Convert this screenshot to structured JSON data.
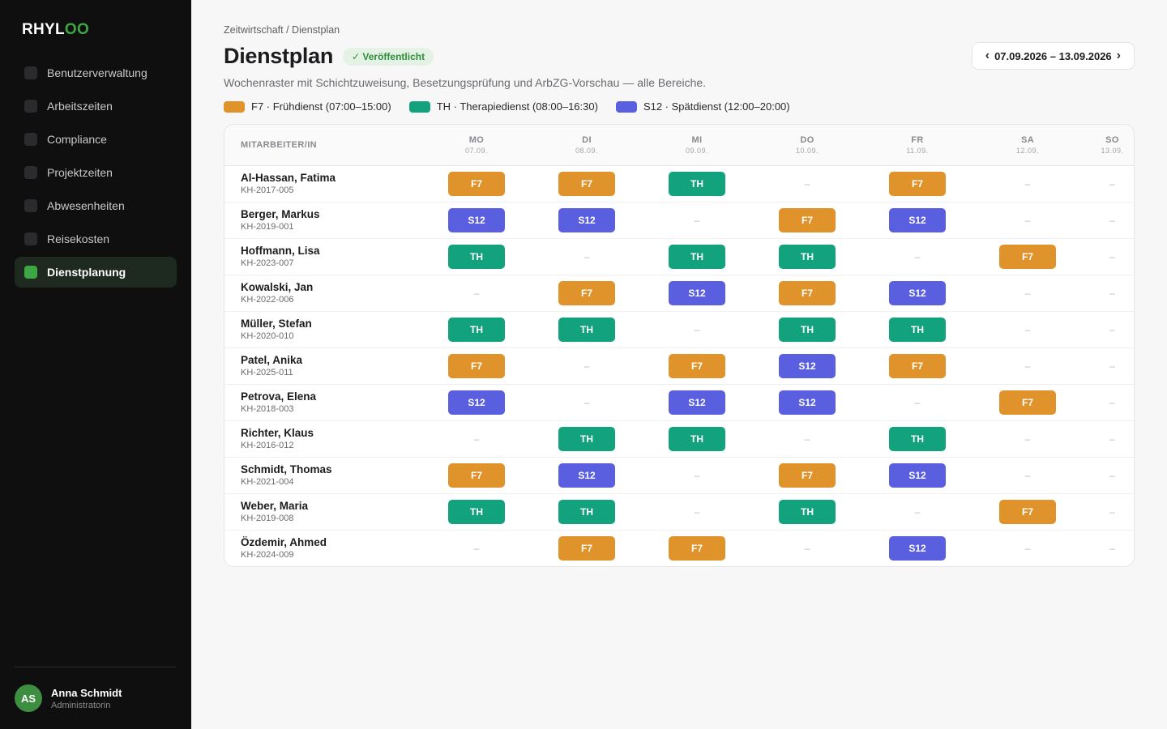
{
  "app": {
    "logo_main": "RHYL",
    "logo_accent": "OO"
  },
  "sidebar": {
    "items": [
      {
        "label": "Benutzerverwaltung",
        "active": false
      },
      {
        "label": "Arbeitszeiten",
        "active": false
      },
      {
        "label": "Compliance",
        "active": false
      },
      {
        "label": "Projektzeiten",
        "active": false
      },
      {
        "label": "Abwesenheiten",
        "active": false
      },
      {
        "label": "Reisekosten",
        "active": false
      },
      {
        "label": "Dienstplanung",
        "active": true
      }
    ],
    "user": {
      "initials": "AS",
      "name": "Anna Schmidt",
      "role": "Administratorin"
    }
  },
  "header": {
    "breadcrumb": "Zeitwirtschaft / Dienstplan",
    "title": "Dienstplan",
    "status_badge": "✓ Veröffentlicht",
    "subtitle": "Wochenraster mit Schichtzuweisung, Besetzungsprüfung und ArbZG-Vorschau — alle Bereiche.",
    "week_range": "07.09.2026 – 13.09.2026",
    "prev_icon": "‹",
    "next_icon": "›"
  },
  "legend": [
    {
      "code": "F7",
      "label": "F7 · Frühdienst (07:00–15:00)",
      "color": "#e0932b"
    },
    {
      "code": "TH",
      "label": "TH · Therapiedienst (08:00–16:30)",
      "color": "#12a27d"
    },
    {
      "code": "S12",
      "label": "S12 · Spätdienst (12:00–20:00)",
      "color": "#5a5fe0"
    }
  ],
  "table": {
    "employee_header": "MITARBEITER/IN",
    "empty_symbol": "–",
    "days": [
      {
        "day": "MO",
        "date": "07.09."
      },
      {
        "day": "DI",
        "date": "08.09."
      },
      {
        "day": "MI",
        "date": "09.09."
      },
      {
        "day": "DO",
        "date": "10.09."
      },
      {
        "day": "FR",
        "date": "11.09."
      },
      {
        "day": "SA",
        "date": "12.09."
      },
      {
        "day": "SO",
        "date": "13.09."
      }
    ],
    "rows": [
      {
        "name": "Al-Hassan, Fatima",
        "id": "KH-2017-005",
        "shifts": [
          "F7",
          "F7",
          "TH",
          "",
          "F7",
          "",
          ""
        ]
      },
      {
        "name": "Berger, Markus",
        "id": "KH-2019-001",
        "shifts": [
          "S12",
          "S12",
          "",
          "F7",
          "S12",
          "",
          ""
        ]
      },
      {
        "name": "Hoffmann, Lisa",
        "id": "KH-2023-007",
        "shifts": [
          "TH",
          "",
          "TH",
          "TH",
          "",
          "F7",
          ""
        ]
      },
      {
        "name": "Kowalski, Jan",
        "id": "KH-2022-006",
        "shifts": [
          "",
          "F7",
          "S12",
          "F7",
          "S12",
          "",
          ""
        ]
      },
      {
        "name": "Müller, Stefan",
        "id": "KH-2020-010",
        "shifts": [
          "TH",
          "TH",
          "",
          "TH",
          "TH",
          "",
          ""
        ]
      },
      {
        "name": "Patel, Anika",
        "id": "KH-2025-011",
        "shifts": [
          "F7",
          "",
          "F7",
          "S12",
          "F7",
          "",
          ""
        ]
      },
      {
        "name": "Petrova, Elena",
        "id": "KH-2018-003",
        "shifts": [
          "S12",
          "",
          "S12",
          "S12",
          "",
          "F7",
          ""
        ]
      },
      {
        "name": "Richter, Klaus",
        "id": "KH-2016-012",
        "shifts": [
          "",
          "TH",
          "TH",
          "",
          "TH",
          "",
          ""
        ]
      },
      {
        "name": "Schmidt, Thomas",
        "id": "KH-2021-004",
        "shifts": [
          "F7",
          "S12",
          "",
          "F7",
          "S12",
          "",
          ""
        ]
      },
      {
        "name": "Weber, Maria",
        "id": "KH-2019-008",
        "shifts": [
          "TH",
          "TH",
          "",
          "TH",
          "",
          "F7",
          ""
        ]
      },
      {
        "name": "Özdemir, Ahmed",
        "id": "KH-2024-009",
        "shifts": [
          "",
          "F7",
          "F7",
          "",
          "S12",
          "",
          ""
        ]
      }
    ]
  }
}
